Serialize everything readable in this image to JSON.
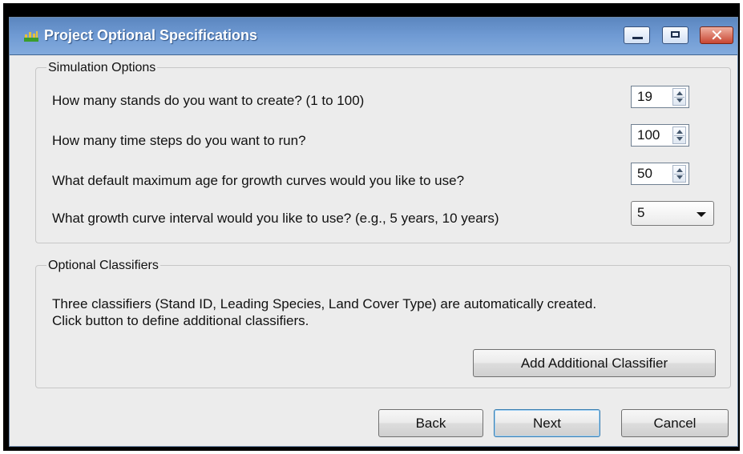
{
  "window": {
    "title": "Project Optional Specifications",
    "icon": "forest-growth-icon",
    "controls": {
      "minimize": "minimize-icon",
      "maximize": "maximize-icon",
      "close": "close-icon",
      "close_glyph": "✕"
    }
  },
  "simulation_options": {
    "label": "Simulation Options",
    "questions": [
      {
        "text": "How many stands do you want to create? (1 to 100)",
        "value": "19",
        "control": "spinner"
      },
      {
        "text": "How many time steps do you want to run?",
        "value": "100",
        "control": "spinner"
      },
      {
        "text": "What default maximum age for growth curves would you like to use?",
        "value": "50",
        "control": "spinner"
      },
      {
        "text": "What growth curve interval would you like to use? (e.g., 5 years, 10 years)",
        "value": "5",
        "control": "dropdown"
      }
    ]
  },
  "optional_classifiers": {
    "label": "Optional Classifiers",
    "description_line1": "Three classifiers (Stand ID, Leading Species, Land Cover Type) are automatically created.",
    "description_line2": "Click button to define additional classifiers.",
    "add_button": "Add Additional Classifier"
  },
  "footer": {
    "back": "Back",
    "next": "Next",
    "cancel": "Cancel"
  },
  "colors": {
    "titlebar": "#6f9ad3",
    "dialog_bg": "#ececec",
    "close_button": "#c84632"
  }
}
